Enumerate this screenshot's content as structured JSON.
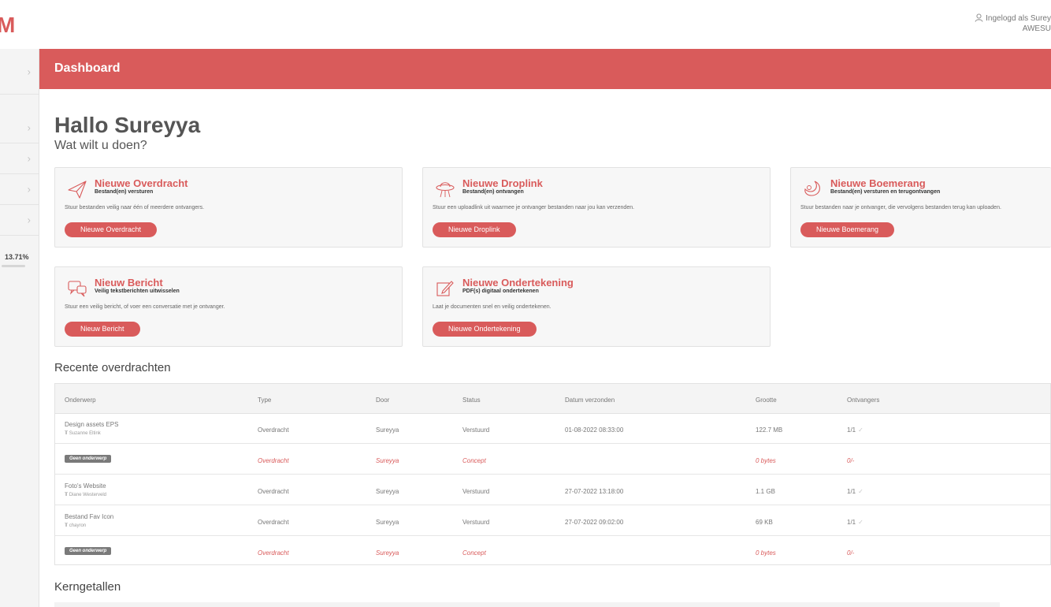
{
  "app": {
    "logo_text": "M",
    "user_label": "Ingelogd als Surey",
    "user_org": "AWESU"
  },
  "sidebar": {
    "percentage": "13.71%"
  },
  "header": {
    "title": "Dashboard"
  },
  "greeting": {
    "title": "Hallo Sureyya",
    "subtitle": "Wat wilt u doen?"
  },
  "actions": [
    {
      "title": "Nieuwe Overdracht",
      "subtitle": "Bestand(en) versturen",
      "description": "Stuur bestanden veilig naar één of meerdere ontvangers.",
      "button": "Nieuwe Overdracht",
      "icon": "paper-plane-icon"
    },
    {
      "title": "Nieuwe Droplink",
      "subtitle": "Bestand(en) ontvangen",
      "description": "Stuur een uploadlink uit waarmee je ontvanger bestanden naar jou kan verzenden.",
      "button": "Nieuwe Droplink",
      "icon": "ufo-icon"
    },
    {
      "title": "Nieuwe Boemerang",
      "subtitle": "Bestand(en) versturen en terugontvangen",
      "description": "Stuur bestanden naar je ontvanger, die vervolgens bestanden terug kan uploaden.",
      "button": "Nieuwe Boemerang",
      "icon": "boomerang-icon"
    },
    {
      "title": "Nieuw Bericht",
      "subtitle": "Veilig tekstberichten uitwisselen",
      "description": "Stuur een veilig bericht, of voer een conversatie met je ontvanger.",
      "button": "Nieuw Bericht",
      "icon": "chat-bubbles-icon"
    },
    {
      "title": "Nieuwe Ondertekening",
      "subtitle": "PDF(s) digitaal ondertekenen",
      "description": "Laat je documenten snel en veilig ondertekenen.",
      "button": "Nieuwe Ondertekening",
      "icon": "sign-pen-icon"
    }
  ],
  "recent": {
    "title": "Recente overdrachten",
    "columns": [
      "Onderwerp",
      "Type",
      "Door",
      "Status",
      "Datum verzonden",
      "Grootte",
      "Ontvangers"
    ],
    "rows": [
      {
        "subject": "Design assets EPS",
        "recipient": "Suzanne Eltink",
        "type": "Overdracht",
        "by": "Sureyya",
        "status": "Verstuurd",
        "date": "01-08-2022 08:33:00",
        "size": "122.7 MB",
        "recipients": "1/1",
        "concept": false
      },
      {
        "subject": "Geen onderwerp",
        "recipient": "",
        "type": "Overdracht",
        "by": "Sureyya",
        "status": "Concept",
        "date": "",
        "size": "0 bytes",
        "recipients": "0/-",
        "concept": true
      },
      {
        "subject": "Foto's Website",
        "recipient": "Diane Westerveld",
        "type": "Overdracht",
        "by": "Sureyya",
        "status": "Verstuurd",
        "date": "27-07-2022 13:18:00",
        "size": "1.1 GB",
        "recipients": "1/1",
        "concept": false
      },
      {
        "subject": "Bestand Fav Icon",
        "recipient": "chayron",
        "type": "Overdracht",
        "by": "Sureyya",
        "status": "Verstuurd",
        "date": "27-07-2022 09:02:00",
        "size": "69 KB",
        "recipients": "1/1",
        "concept": false
      },
      {
        "subject": "Geen onderwerp",
        "recipient": "",
        "type": "Overdracht",
        "by": "Sureyya",
        "status": "Concept",
        "date": "",
        "size": "0 bytes",
        "recipients": "0/-",
        "concept": true
      }
    ]
  },
  "kerngetallen": {
    "title": "Kerngetallen"
  },
  "colors": {
    "accent": "#d95b5b",
    "sidebar_bg": "#f4f4f4",
    "card_bg": "#f7f7f7"
  }
}
